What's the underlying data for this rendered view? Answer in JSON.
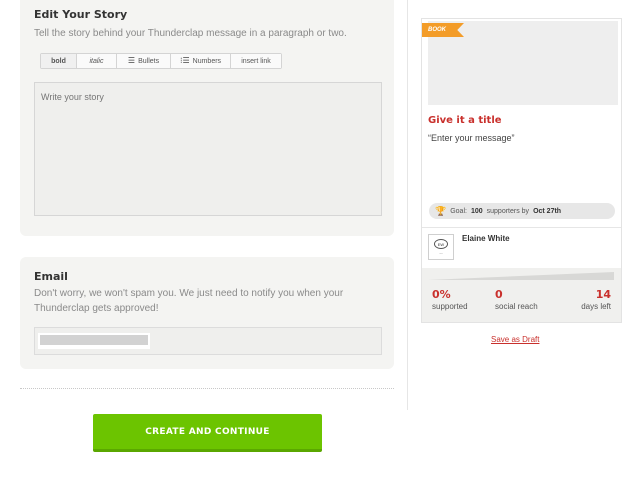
{
  "story": {
    "title": "Edit Your Story",
    "description": "Tell the story behind your Thunderclap message in a paragraph or two.",
    "placeholder": "Write your story",
    "toolbar": {
      "bold": "bold",
      "italic": "italic",
      "bullets": "Bullets",
      "numbers": "Numbers",
      "insert_link": "insert link"
    }
  },
  "email": {
    "title": "Email",
    "description": "Don't worry, we won't spam you. We just need to notify you when your Thunderclap gets approved!"
  },
  "cta": {
    "label": "CREATE AND CONTINUE",
    "color": "#6cc400"
  },
  "preview": {
    "ribbon": "BOOK",
    "title": "Give it a title",
    "message": "“Enter your message”",
    "goal": {
      "prefix": "Goal:",
      "count": "100",
      "middle": "supporters by",
      "date": "Oct 27th"
    },
    "author": "Elaine White",
    "progress_fraction": 0,
    "stats": [
      {
        "value": "0%",
        "label": "supported"
      },
      {
        "value": "0",
        "label": "social reach"
      },
      {
        "value": "14",
        "label": "days left"
      }
    ],
    "accent_color": "#c9302c",
    "ribbon_color": "#f39c28"
  },
  "save_draft": "Save as Draft"
}
